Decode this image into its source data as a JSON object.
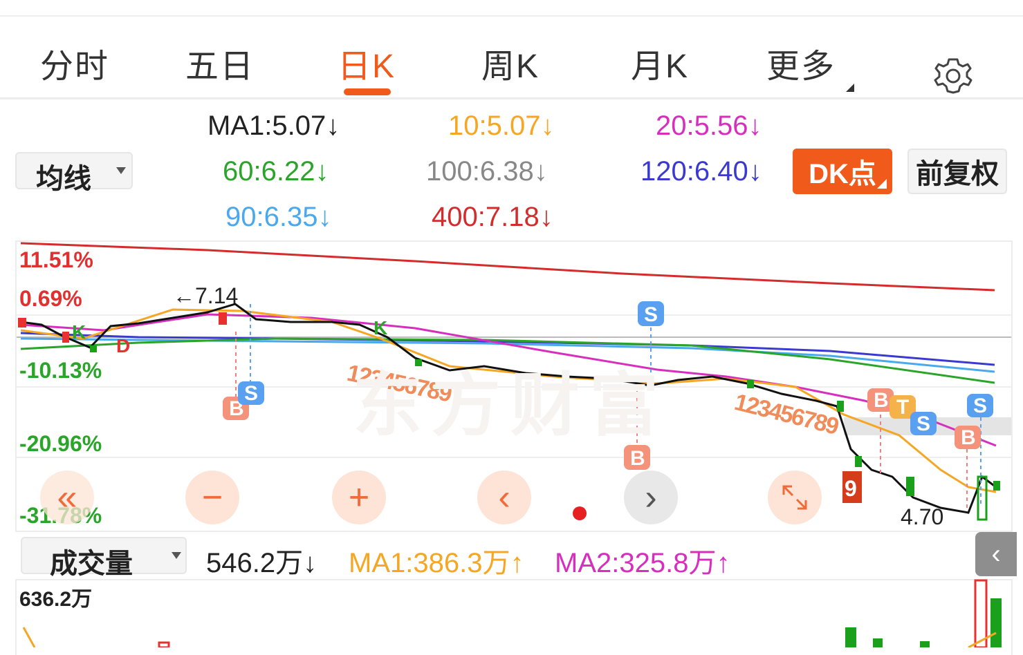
{
  "tabs": [
    {
      "label": "分时"
    },
    {
      "label": "五日"
    },
    {
      "label": "日K"
    },
    {
      "label": "周K"
    },
    {
      "label": "月K"
    },
    {
      "label": "更多"
    }
  ],
  "active_tab": "日K",
  "indicator_select": "均线",
  "ma": {
    "ma1": "MA1:5.07↓",
    "ma10": "10:5.07↓",
    "ma20": "20:5.56↓",
    "ma60": "60:6.22↓",
    "ma100": "100:6.38↓",
    "ma120": "120:6.40↓",
    "ma90": "90:6.35↓",
    "ma400": "400:7.18↓"
  },
  "dk_button": "DK点",
  "adjust_button": "前复权",
  "chart": {
    "pct_labels": [
      "11.51%",
      "0.69%",
      "-10.13%",
      "-20.96%",
      "-31.78%"
    ],
    "high_annotation": "←7.14",
    "low_annotation": "4.70",
    "watermark": "东方财富",
    "signal_labels": {
      "b": "B",
      "s": "S",
      "k": "K",
      "d": "D",
      "t": "T",
      "seq1": "123456789",
      "seq2": "123456789"
    }
  },
  "volume": {
    "select": "成交量",
    "value": "546.2万↓",
    "ma1": "MA1:386.3万↑",
    "ma2": "MA2:325.8万↑",
    "max": "636.2万"
  },
  "colors": {
    "accent": "#f05a1a",
    "up": "#e83030",
    "down": "#1aa01a",
    "ma10": "#f5a623",
    "ma20": "#d62fbe",
    "ma60": "#2aa52a",
    "ma120": "#3a3ad0",
    "ma90": "#4aa8ec",
    "ma400": "#d42c2c"
  }
}
